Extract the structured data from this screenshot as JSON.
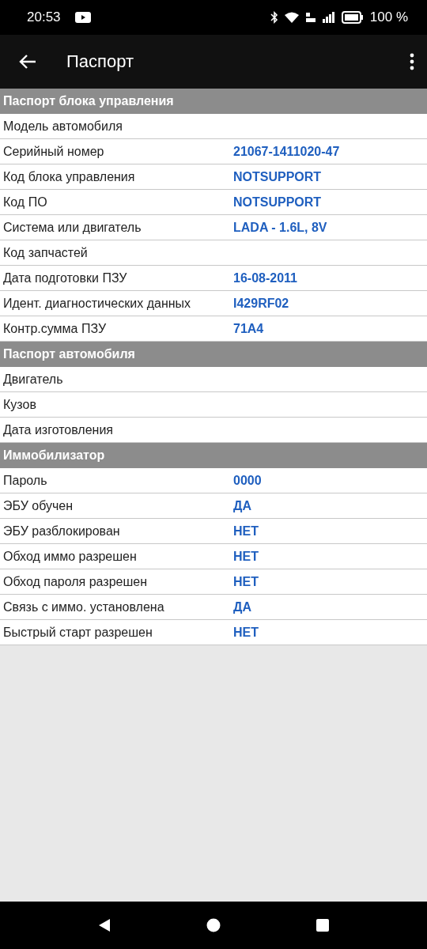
{
  "status_bar": {
    "time": "20:53",
    "battery": "100 %"
  },
  "app_bar": {
    "title": "Паспорт"
  },
  "sections": [
    {
      "title": "Паспорт блока управления",
      "rows": [
        {
          "label": "Модель автомобиля"
        },
        {
          "label": "Серийный номер",
          "value": "21067-1411020-47"
        },
        {
          "label": "Код блока управления",
          "value": "NOTSUPPORT"
        },
        {
          "label": "Код ПО",
          "value": "NOTSUPPORT"
        },
        {
          "label": "Система или двигатель",
          "value": "LADA - 1.6L, 8V"
        },
        {
          "label": "Код запчастей"
        },
        {
          "label": "Дата подготовки ПЗУ",
          "value": "16-08-2011"
        },
        {
          "label": "Идент. диагностических данных",
          "value": "I429RF02"
        },
        {
          "label": "Контр.сумма ПЗУ",
          "value": "71A4"
        }
      ]
    },
    {
      "title": "Паспорт автомобиля",
      "rows": [
        {
          "label": "Двигатель"
        },
        {
          "label": "Кузов"
        },
        {
          "label": "Дата изготовления"
        }
      ]
    },
    {
      "title": "Иммобилизатор",
      "rows": [
        {
          "label": "Пароль",
          "value": "0000"
        },
        {
          "label": "ЭБУ обучен",
          "value": "ДА"
        },
        {
          "label": "ЭБУ разблокирован",
          "value": "НЕТ"
        },
        {
          "label": "Обход иммо разрешен",
          "value": "НЕТ"
        },
        {
          "label": "Обход пароля разрешен",
          "value": "НЕТ"
        },
        {
          "label": "Связь с иммо. установлена",
          "value": "ДА"
        },
        {
          "label": "Быстрый старт разрешен",
          "value": "НЕТ"
        }
      ]
    }
  ]
}
